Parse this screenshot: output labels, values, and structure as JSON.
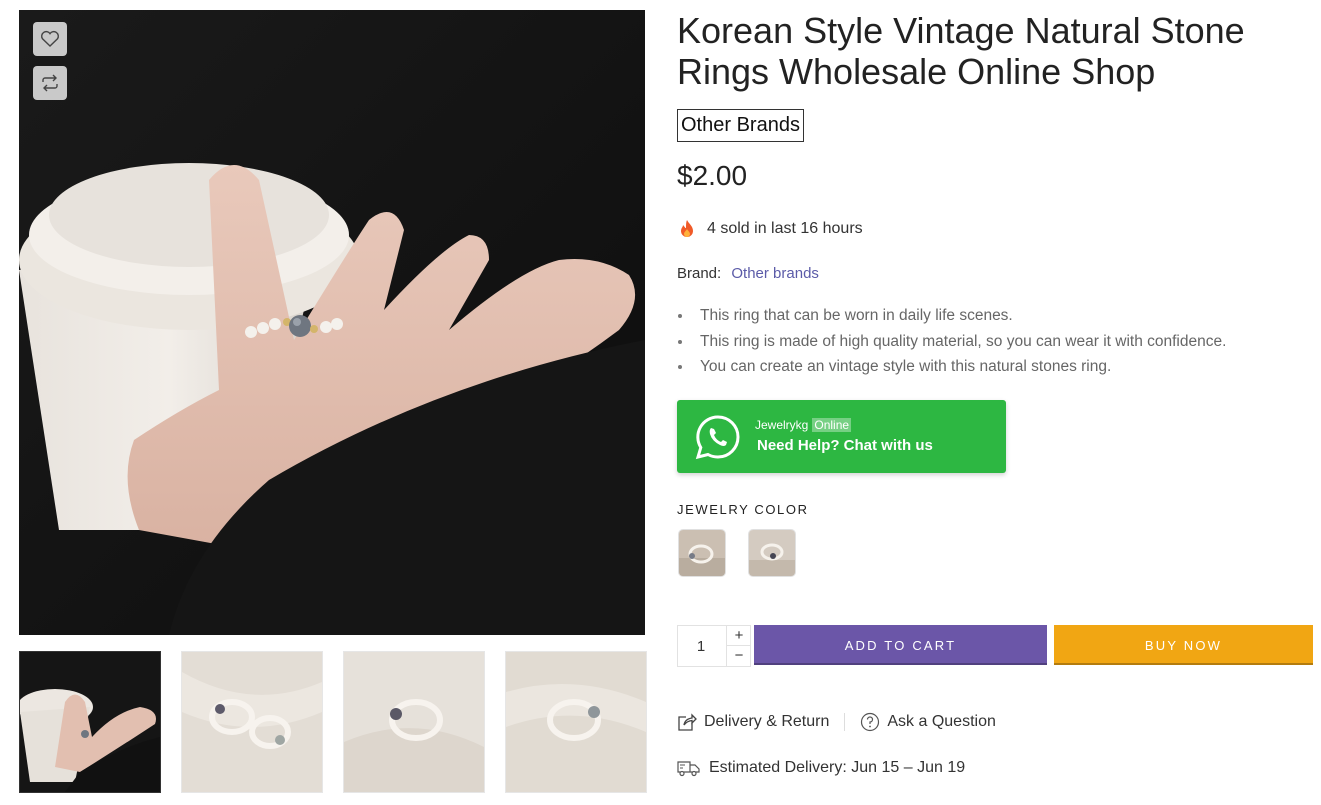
{
  "product": {
    "title": "Korean Style Vintage Natural Stone Rings Wholesale Online Shop",
    "brand_badge": "Other Brands",
    "price": "$2.00",
    "sold_text": "4 sold in last 16 hours",
    "brand_label": "Brand:",
    "brand_link": "Other brands",
    "features": [
      "This ring that can be worn in daily life scenes.",
      "This ring is made of high quality material, so you can wear it with confidence.",
      "You can create an vintage style with this natural stones ring."
    ]
  },
  "whatsapp": {
    "name": "Jewelrykg",
    "status": "Online",
    "cta": "Need Help? Chat with us",
    "color": "#2db742"
  },
  "variants": {
    "label": "JEWELRY COLOR"
  },
  "purchase": {
    "quantity": "1",
    "plus": "+",
    "minus": "−",
    "add_to_cart": "ADD TO CART",
    "buy_now": "BUY NOW",
    "add_color": "#6b56a8",
    "buy_color": "#f1a613"
  },
  "links": {
    "delivery_return": "Delivery & Return",
    "ask_question": "Ask a Question"
  },
  "delivery": {
    "label": "Estimated Delivery:",
    "range": "Jun 15 – Jun 19"
  },
  "icons": {
    "wishlist": "heart-icon",
    "compare": "compare-arrows-icon",
    "fire": "fire-icon",
    "whatsapp": "whatsapp-icon",
    "share": "share-icon",
    "question": "question-icon",
    "truck": "truck-icon"
  }
}
